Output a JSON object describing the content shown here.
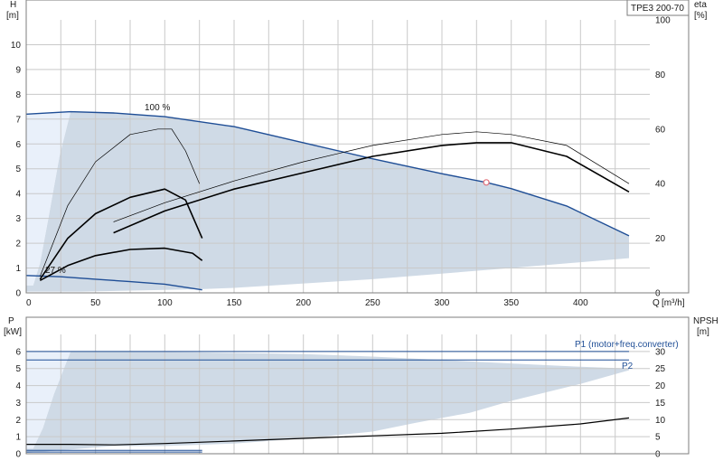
{
  "colors": {
    "curve": "#1f4e96",
    "black": "#000000",
    "area": "#cfdae6",
    "lightarea": "#e9f0fa",
    "grid": "#c9c9c9",
    "marker": "#e0707a"
  },
  "chart_data": [
    {
      "type": "line",
      "title": "TPE3 200-70",
      "ylabel": "H",
      "yunit": "[m]",
      "y2label": "eta",
      "y2unit": "[%]",
      "xlabel": "Q",
      "xunit": "[m³/h]",
      "xlim": [
        0,
        450
      ],
      "ylim": [
        0,
        11
      ],
      "y2lim": [
        0,
        100
      ],
      "grid": true,
      "x_ticks": [
        "0",
        "50",
        "100",
        "150",
        "200",
        "250",
        "300",
        "350",
        "400"
      ],
      "y_ticks": [
        "0",
        "1",
        "2",
        "3",
        "4",
        "5",
        "6",
        "7",
        "8",
        "9",
        "10"
      ],
      "y2_ticks": [
        "0",
        "20",
        "40",
        "60",
        "80",
        "100"
      ],
      "annotations": [
        {
          "text": "100 %",
          "x": 95,
          "y": 7.4
        },
        {
          "text": "27 %",
          "x": 15,
          "y": 0.85
        }
      ],
      "operating_point": {
        "x": 332,
        "y": 4.45
      },
      "region_light": [
        [
          0,
          7.2
        ],
        [
          32,
          7.3
        ],
        [
          24,
          5.5
        ],
        [
          16,
          3.0
        ],
        [
          10,
          1.2
        ],
        [
          5,
          0.3
        ],
        [
          0,
          0.3
        ]
      ],
      "region": [
        [
          0,
          0.3
        ],
        [
          5,
          0.3
        ],
        [
          10,
          1.2
        ],
        [
          16,
          3.0
        ],
        [
          24,
          5.5
        ],
        [
          32,
          7.3
        ],
        [
          63,
          7.25
        ],
        [
          100,
          7.1
        ],
        [
          150,
          6.7
        ],
        [
          200,
          6.05
        ],
        [
          250,
          5.4
        ],
        [
          300,
          4.8
        ],
        [
          332,
          4.45
        ],
        [
          350,
          4.2
        ],
        [
          390,
          3.5
        ],
        [
          435,
          2.3
        ],
        [
          435,
          1.4
        ],
        [
          350,
          1.0
        ],
        [
          250,
          0.55
        ],
        [
          150,
          0.2
        ],
        [
          127,
          0.15
        ],
        [
          100,
          0.12
        ],
        [
          40,
          0.05
        ],
        [
          0,
          0.05
        ]
      ],
      "series": [
        {
          "name": "100 %",
          "role": "H",
          "x": [
            0,
            32,
            63,
            100,
            150,
            200,
            250,
            300,
            332,
            350,
            390,
            435
          ],
          "y": [
            7.2,
            7.3,
            7.25,
            7.1,
            6.7,
            6.05,
            5.4,
            4.8,
            4.45,
            4.2,
            3.5,
            2.3
          ]
        },
        {
          "name": "27 %",
          "role": "H",
          "x": [
            0,
            25,
            50,
            75,
            100,
            127
          ],
          "y": [
            0.7,
            0.65,
            0.55,
            0.45,
            0.35,
            0.12
          ]
        },
        {
          "role": "H_dotted",
          "x": [
            10,
            30,
            50,
            75,
            100,
            120,
            127
          ],
          "y": [
            0.5,
            1.1,
            1.5,
            1.75,
            1.8,
            1.6,
            1.3
          ]
        },
        {
          "role": "eta_thin",
          "x": [
            10,
            30,
            50,
            75,
            95,
            105,
            115,
            125
          ],
          "y": [
            6,
            32,
            48,
            58,
            60,
            60,
            52,
            40
          ]
        },
        {
          "role": "eta",
          "x": [
            10,
            30,
            50,
            75,
            100,
            115,
            127
          ],
          "y": [
            5,
            20,
            29,
            35,
            38,
            34,
            20
          ]
        },
        {
          "role": "eta_thin",
          "x": [
            63,
            100,
            150,
            200,
            250,
            300,
            325,
            350,
            390,
            435
          ],
          "y": [
            26,
            33,
            41,
            48,
            54,
            58,
            59,
            58,
            54,
            40
          ]
        },
        {
          "role": "eta",
          "x": [
            63,
            100,
            150,
            200,
            250,
            300,
            325,
            350,
            390,
            435
          ],
          "y": [
            22,
            30,
            38,
            44,
            50,
            54,
            55,
            55,
            50,
            37
          ]
        }
      ]
    },
    {
      "type": "line",
      "ylabel": "P",
      "yunit": "[kW]",
      "y2label": "NPSH",
      "y2unit": "[m]",
      "xlim": [
        0,
        450
      ],
      "ylim": [
        0,
        7
      ],
      "y2lim": [
        0,
        35
      ],
      "grid": true,
      "y_ticks": [
        "0",
        "1",
        "2",
        "3",
        "4",
        "5",
        "6"
      ],
      "y2_ticks": [
        "0",
        "5",
        "10",
        "15",
        "20",
        "25",
        "30"
      ],
      "region_light": [
        [
          0,
          6.0
        ],
        [
          32,
          6.0
        ],
        [
          20,
          3.5
        ],
        [
          12,
          1.5
        ],
        [
          5,
          0.3
        ],
        [
          0,
          0.3
        ]
      ],
      "region": [
        [
          0,
          0.3
        ],
        [
          5,
          0.3
        ],
        [
          12,
          1.5
        ],
        [
          20,
          3.5
        ],
        [
          32,
          6.0
        ],
        [
          63,
          6.0
        ],
        [
          120,
          5.95
        ],
        [
          200,
          5.85
        ],
        [
          250,
          5.7
        ],
        [
          300,
          5.5
        ],
        [
          350,
          5.3
        ],
        [
          400,
          5.1
        ],
        [
          435,
          5.0
        ],
        [
          435,
          4.9
        ],
        [
          400,
          4.1
        ],
        [
          350,
          3.1
        ],
        [
          320,
          2.4
        ],
        [
          280,
          1.8
        ],
        [
          250,
          1.3
        ],
        [
          200,
          0.9
        ],
        [
          150,
          0.6
        ],
        [
          100,
          0.45
        ],
        [
          63,
          0.45
        ],
        [
          0,
          0.05
        ]
      ],
      "series": [
        {
          "name": "P1 (motor+freq.converter)",
          "role": "P1",
          "x": [
            0,
            32,
            63,
            435
          ],
          "y": [
            6.0,
            6.0,
            6.0,
            6.0
          ]
        },
        {
          "name": "P2",
          "role": "P2",
          "x": [
            0,
            32,
            63,
            435
          ],
          "y": [
            5.5,
            5.5,
            5.5,
            5.5
          ]
        },
        {
          "role": "NPSH",
          "x": [
            0,
            32,
            63,
            100,
            150,
            200,
            250,
            300,
            350,
            400,
            435
          ],
          "y": [
            0.55,
            0.55,
            0.52,
            0.6,
            0.75,
            0.9,
            1.05,
            1.2,
            1.45,
            1.75,
            2.1
          ]
        },
        {
          "role": "P_low",
          "x": [
            0,
            50,
            100,
            127
          ],
          "y": [
            0.2,
            0.2,
            0.2,
            0.2
          ]
        },
        {
          "role": "P_low2",
          "x": [
            0,
            50,
            100,
            127
          ],
          "y": [
            0.1,
            0.1,
            0.1,
            0.1
          ]
        }
      ]
    }
  ]
}
